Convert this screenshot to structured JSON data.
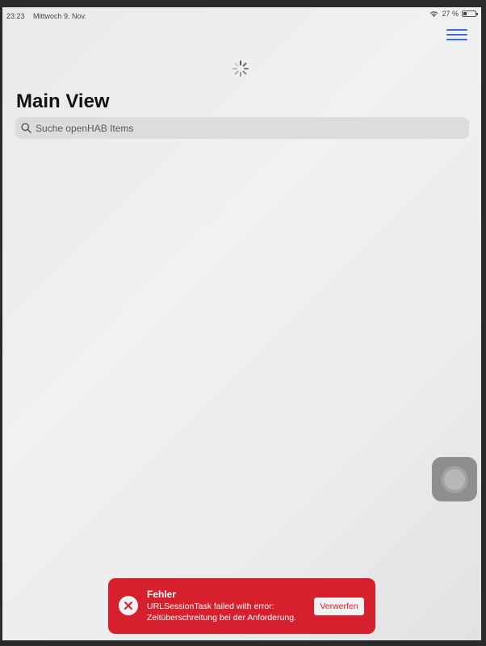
{
  "status_bar": {
    "time": "23:23",
    "date": "Mittwoch 9. Nov.",
    "battery_text": "27 %",
    "battery_level_percent": 27,
    "wifi_icon": "wifi-icon",
    "battery_icon": "battery-icon"
  },
  "header": {
    "menu_icon": "hamburger-menu-icon",
    "menu_color": "#3a6fd9",
    "loading_indicator": "spinner-icon"
  },
  "main": {
    "title": "Main View",
    "search": {
      "placeholder": "Suche openHAB Items",
      "value": ""
    }
  },
  "toast": {
    "title": "Fehler",
    "message_line1": "URLSessionTask failed with error:",
    "message_line2": "Zeitüberschreitung bei der Anforderung.",
    "dismiss_label": "Verwerfen",
    "color": "#d6202e",
    "icon": "close-icon"
  },
  "overlay": {
    "assistive_touch_icon": "assistive-touch-icon"
  }
}
